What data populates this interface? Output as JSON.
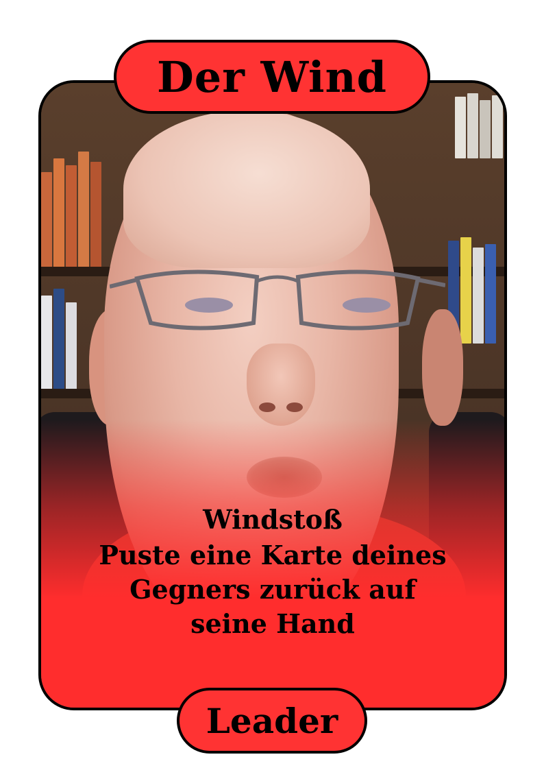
{
  "card": {
    "title": "Der Wind",
    "ability_name": "Windstoß",
    "ability_text_lines": [
      "Puste eine Karte deines",
      "Gegners zurück auf",
      "seine Hand"
    ],
    "type": "Leader"
  },
  "colors": {
    "banner": "#ff3333",
    "border": "#000000",
    "fade": "#ff2d2d"
  }
}
